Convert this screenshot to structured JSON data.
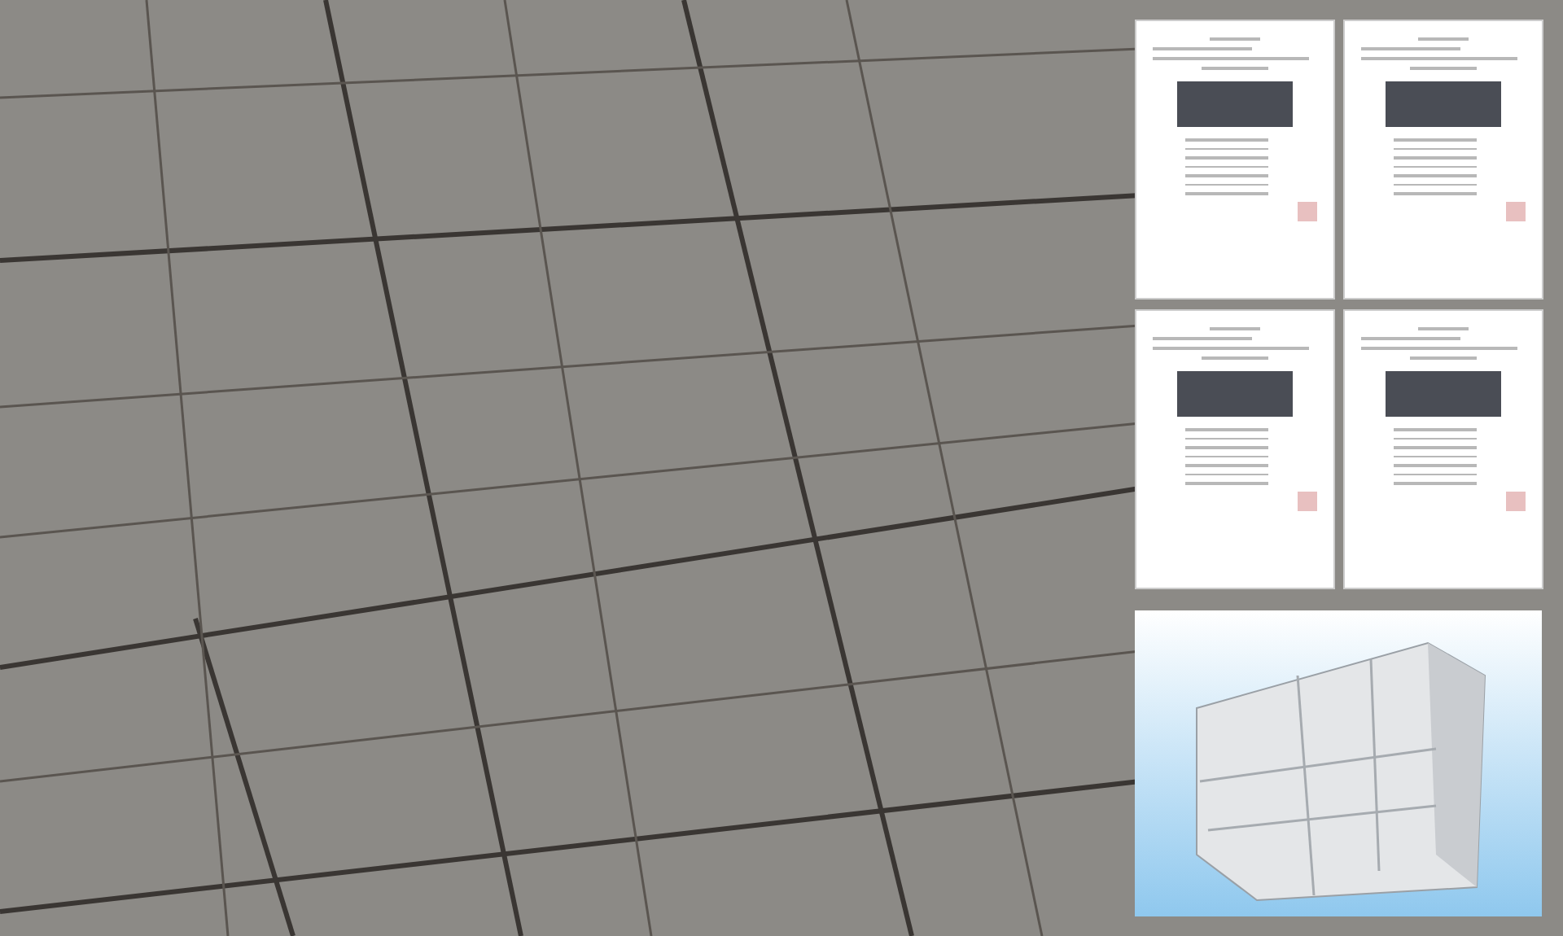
{
  "background": {
    "kind": "stone-wall"
  },
  "documents": [
    {
      "kind": "certificate"
    },
    {
      "kind": "certificate"
    },
    {
      "kind": "certificate"
    },
    {
      "kind": "certificate"
    }
  ],
  "product": {
    "kind": "panel"
  }
}
